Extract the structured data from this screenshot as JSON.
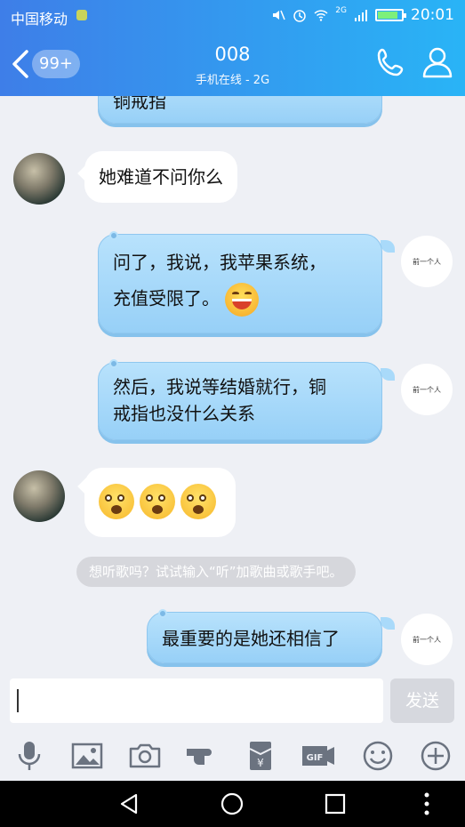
{
  "status_bar": {
    "carrier": "中国移动",
    "time": "20:01",
    "network_label": "2G",
    "icons": [
      "sim-icon",
      "mute-icon",
      "alarm-icon",
      "wifi-icon",
      "signal-icon",
      "battery-icon"
    ],
    "battery_level": 0.8
  },
  "header": {
    "back_icon": "chevron-left-icon",
    "unread_badge": "99+",
    "title": "008",
    "subtitle": "手机在线 - 2G",
    "call_icon": "phone-icon",
    "profile_icon": "person-icon"
  },
  "messages": [
    {
      "side": "right",
      "text": "铜戒指",
      "partial": true
    },
    {
      "side": "left",
      "text": "她难道不问你么"
    },
    {
      "side": "right",
      "line1": "问了，我说，我苹果系统，",
      "line2": "充值受限了。",
      "emoji": "grin-emoji"
    },
    {
      "side": "right",
      "line1": "然后，我说等结婚就行，铜",
      "line2": "戒指也没什么关系"
    },
    {
      "side": "left",
      "emoji": "shocked-emoji",
      "emoji_count": 3
    },
    {
      "side": "right",
      "text": "最重要的是她还相信了"
    }
  ],
  "my_avatar_text": "前一个人",
  "hint": "想听歌吗？试试输入“听”加歌曲或歌手吧。",
  "input": {
    "value": "",
    "send_label": "发送"
  },
  "toolbar_icons": [
    "microphone-icon",
    "image-icon",
    "camera-icon",
    "poke-icon",
    "red-packet-icon",
    "gif-icon",
    "emoji-icon",
    "plus-icon"
  ],
  "navbar_icons": [
    "back-triangle-icon",
    "home-circle-icon",
    "recents-square-icon",
    "more-dots-icon"
  ],
  "colors": {
    "header_start": "#3e7ee8",
    "header_end": "#29b4f6",
    "my_bubble": "#a9dafa",
    "background": "#eef0f5"
  }
}
